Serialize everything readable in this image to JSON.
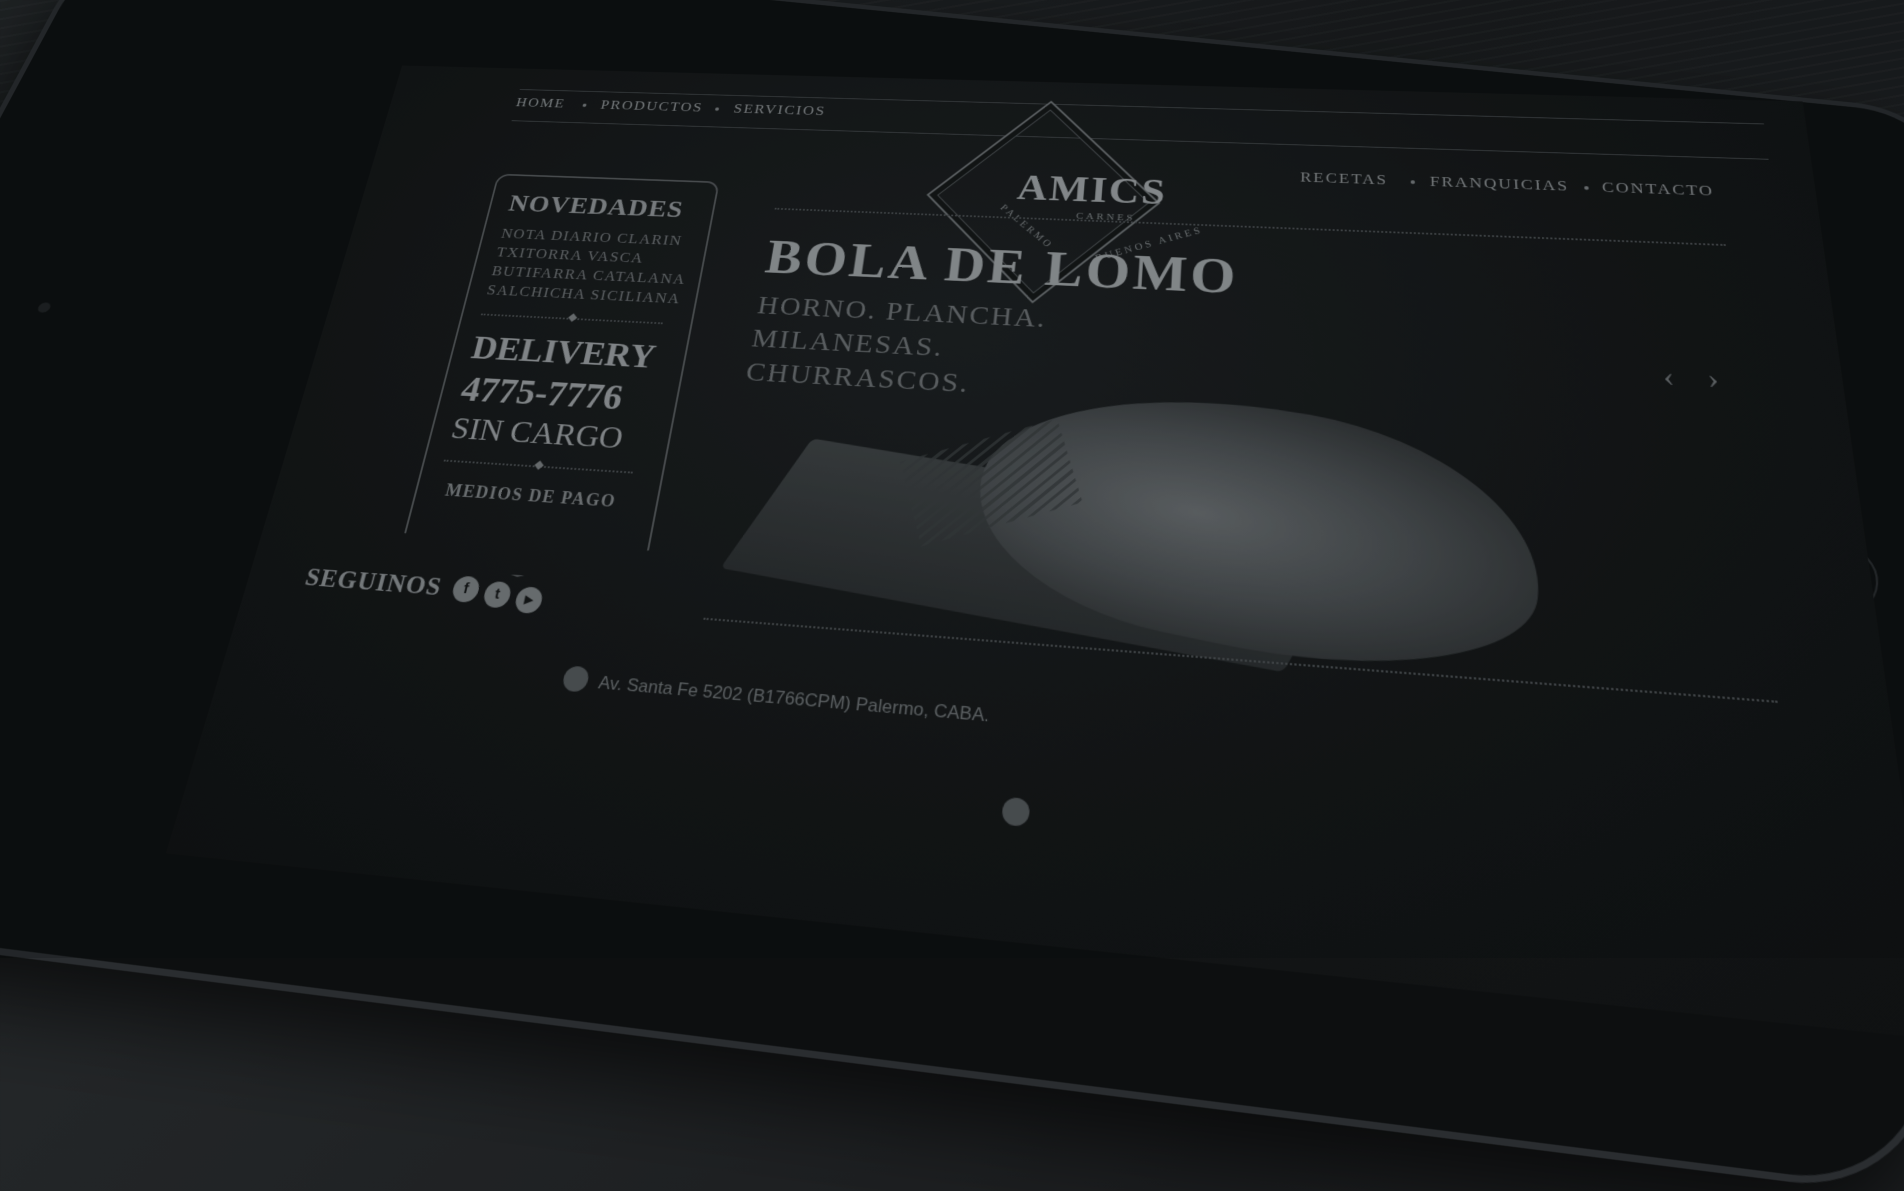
{
  "nav": {
    "items": [
      "HOME",
      "PRODUCTOS",
      "SERVICIOS",
      "RECETAS",
      "FRANQUICIAS",
      "CONTACTO"
    ]
  },
  "logo": {
    "name": "AMICS",
    "sub": "CARNES",
    "left": "PALERMO",
    "right": "BUENOS AIRES"
  },
  "panel": {
    "title": "NOVEDADES",
    "items": [
      "NOTA DIARIO CLARIN",
      "TXITORRA VASCA",
      "BUTIFARRA CATALANA",
      "SALCHICHA SICILIANA"
    ],
    "delivery": "DELIVERY",
    "phone": "4775-7776",
    "free": "SIN CARGO",
    "payment": "MEDIOS DE PAGO"
  },
  "hero": {
    "title": "BOLA DE LOMO",
    "lines": [
      "HORNO. PLANCHA.",
      "MILANESAS.",
      "CHURRASCOS."
    ],
    "prev": "‹",
    "next": "›"
  },
  "footer": {
    "follow": "SEGUINOS",
    "social": [
      "f",
      "t",
      "▶"
    ],
    "social_icons": [
      "facebook-icon",
      "twitter-icon",
      "youtube-icon"
    ],
    "address": "Av. Santa Fe 5202 (B1766CPM) Palermo, CABA."
  }
}
